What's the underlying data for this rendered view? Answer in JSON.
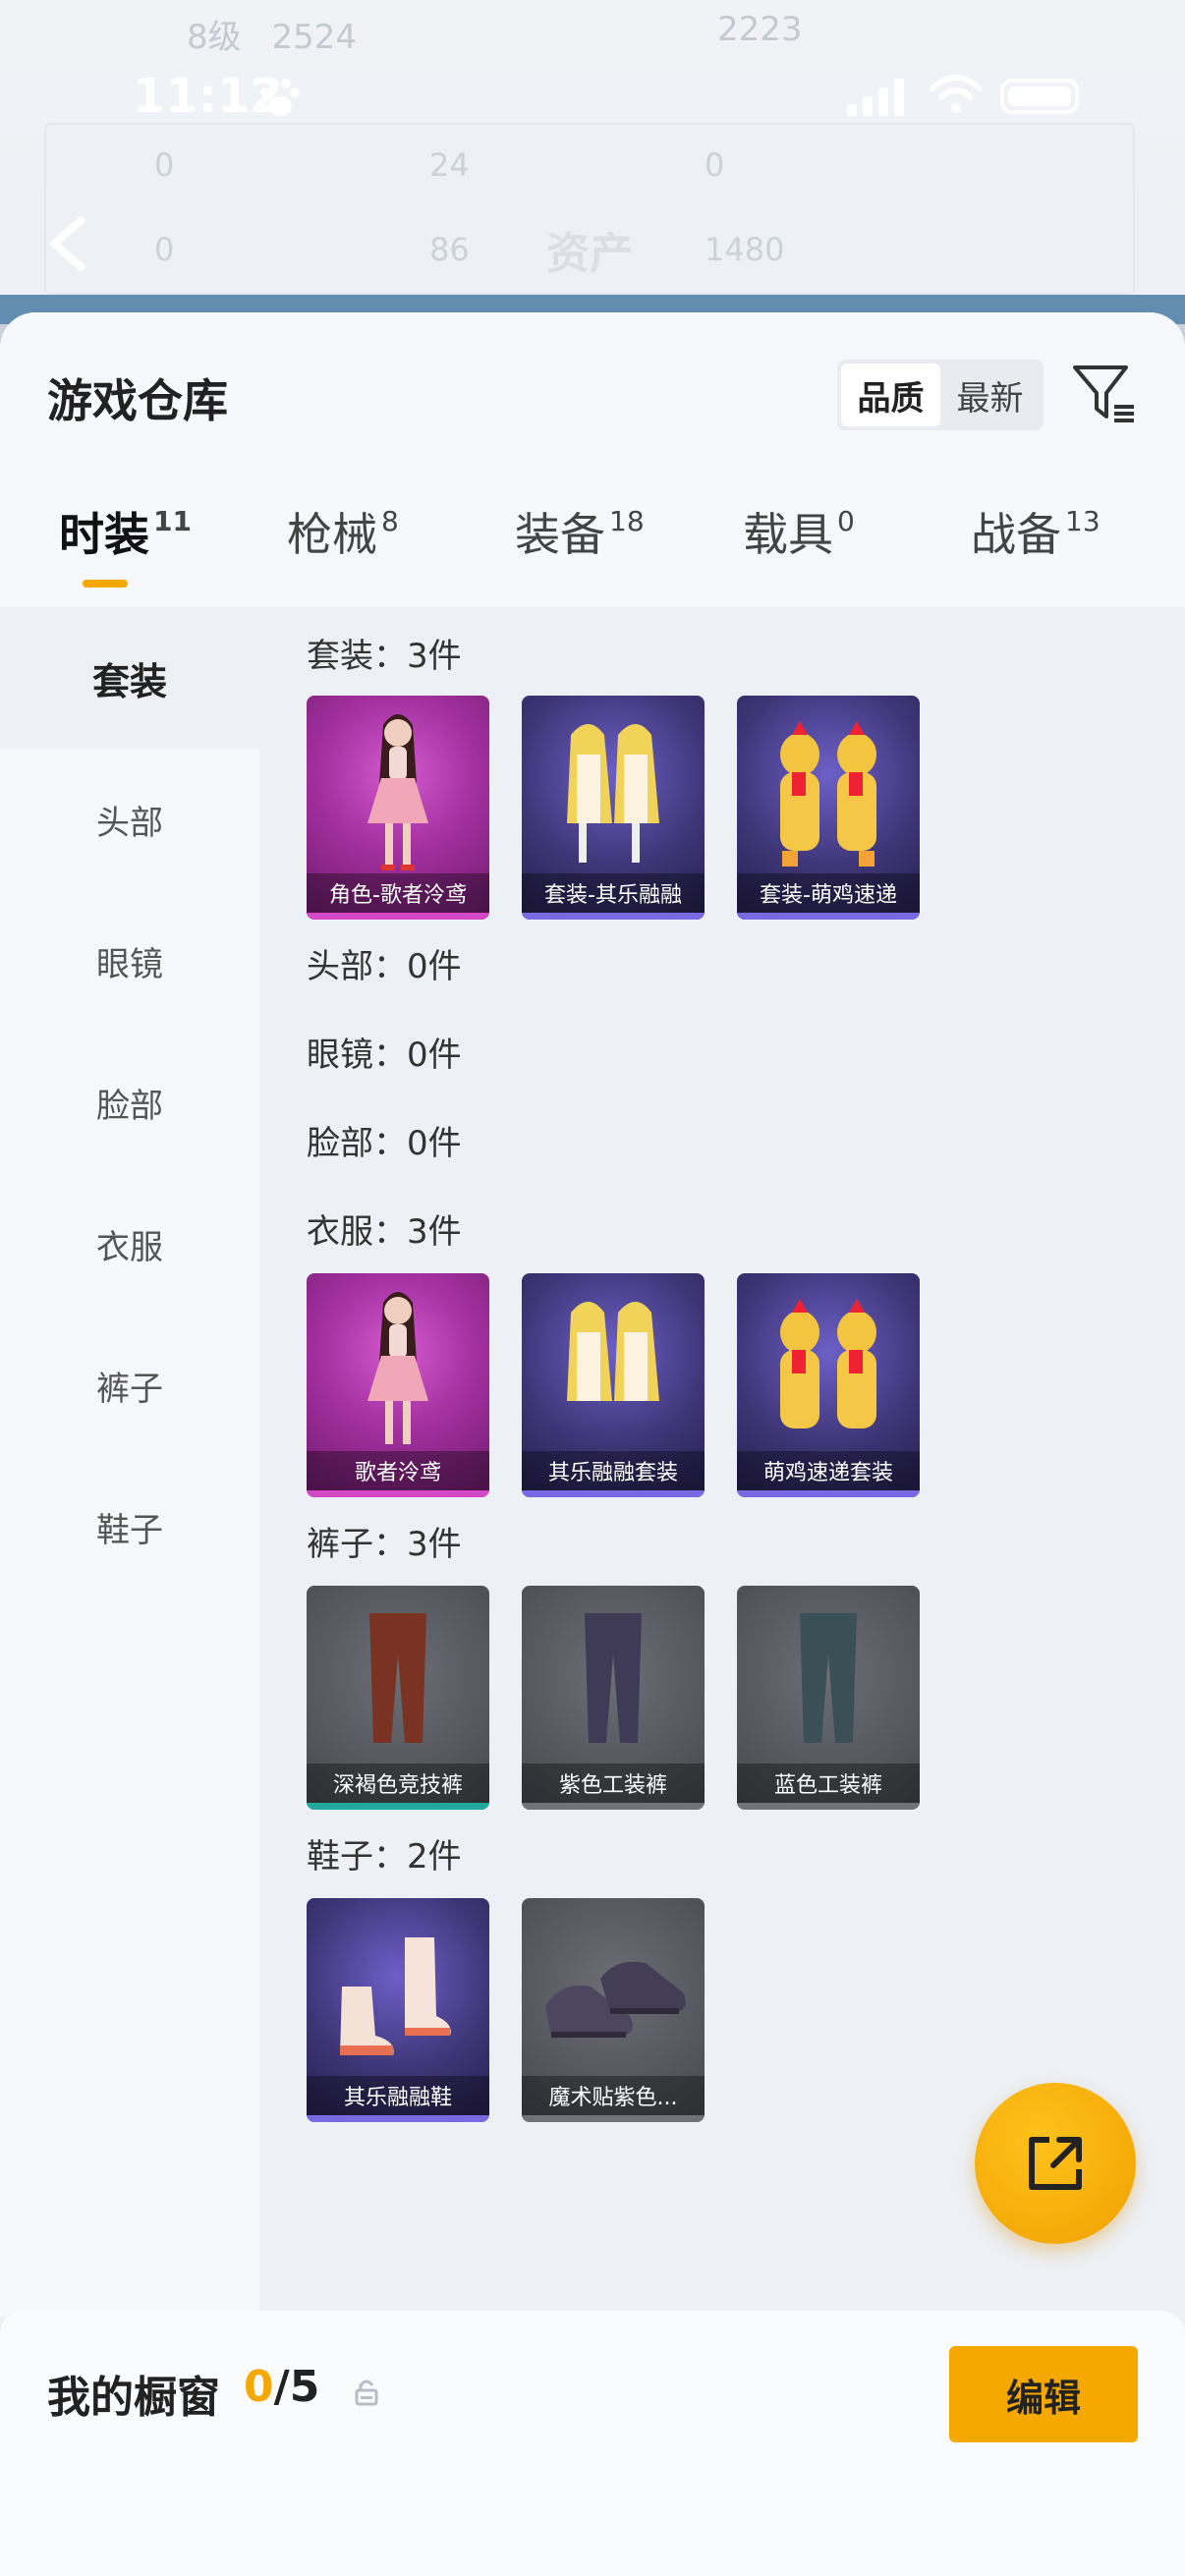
{
  "background": {
    "level": "8级",
    "score_a": "2524",
    "score_b": "2223",
    "title": "资产",
    "stats": [
      "0",
      "24",
      "0",
      "0",
      "86",
      "1480"
    ]
  },
  "status_bar": {
    "time": "11:12"
  },
  "sheet": {
    "title": "游戏仓库",
    "sort_options": [
      "品质",
      "最新"
    ],
    "active_sort": "品质"
  },
  "tabs": [
    {
      "label": "时装",
      "count": "11"
    },
    {
      "label": "枪械",
      "count": "8"
    },
    {
      "label": "装备",
      "count": "18"
    },
    {
      "label": "载具",
      "count": "0"
    },
    {
      "label": "战备",
      "count": "13"
    }
  ],
  "sidebar": [
    "套装",
    "头部",
    "眼镜",
    "脸部",
    "衣服",
    "裤子",
    "鞋子"
  ],
  "sections": {
    "suit": {
      "title": "套装：3件",
      "items": [
        "角色-歌者泠鸢",
        "套装-其乐融融",
        "套装-萌鸡速递"
      ]
    },
    "head": {
      "title": "头部：0件"
    },
    "glasses": {
      "title": "眼镜：0件"
    },
    "face": {
      "title": "脸部：0件"
    },
    "clothes": {
      "title": "衣服：3件",
      "items": [
        "歌者泠鸢",
        "其乐融融套装",
        "萌鸡速递套装"
      ]
    },
    "pants": {
      "title": "裤子：3件",
      "items": [
        "深褐色竞技裤",
        "紫色工装裤",
        "蓝色工装裤"
      ]
    },
    "shoes": {
      "title": "鞋子：2件",
      "items": [
        "其乐融融鞋",
        "魔术贴紫色..."
      ]
    }
  },
  "showcase": {
    "label": "我的橱窗",
    "current": "0",
    "total": "/5"
  },
  "edit_label": "编辑",
  "colors": {
    "accent": "#f5a800",
    "rarity_purple": "#d448c8",
    "rarity_blue": "#7b68e3",
    "rarity_grey": "#70737a"
  }
}
